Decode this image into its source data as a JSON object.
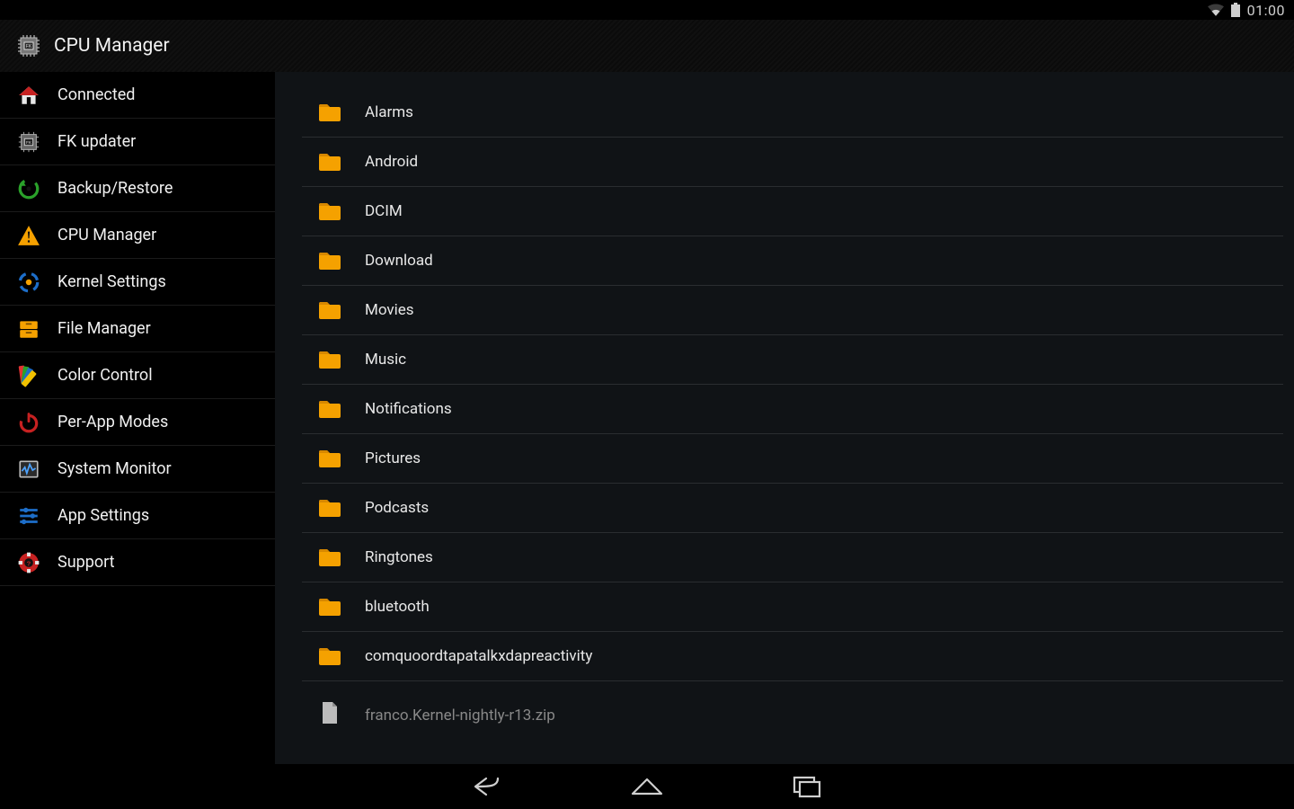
{
  "status": {
    "time": "01:00"
  },
  "header": {
    "title": "CPU Manager"
  },
  "sidebar": {
    "items": [
      {
        "id": "connected",
        "label": "Connected",
        "icon": "home"
      },
      {
        "id": "fk-updater",
        "label": "FK updater",
        "icon": "chip"
      },
      {
        "id": "backup-restore",
        "label": "Backup/Restore",
        "icon": "restore"
      },
      {
        "id": "cpu-manager",
        "label": "CPU Manager",
        "icon": "warning"
      },
      {
        "id": "kernel-settings",
        "label": "Kernel Settings",
        "icon": "target"
      },
      {
        "id": "file-manager",
        "label": "File Manager",
        "icon": "drawer"
      },
      {
        "id": "color-control",
        "label": "Color Control",
        "icon": "swatch"
      },
      {
        "id": "per-app-modes",
        "label": "Per-App Modes",
        "icon": "power"
      },
      {
        "id": "system-monitor",
        "label": "System Monitor",
        "icon": "monitor"
      },
      {
        "id": "app-settings",
        "label": "App Settings",
        "icon": "sliders"
      },
      {
        "id": "support",
        "label": "Support",
        "icon": "lifebuoy"
      }
    ]
  },
  "files": {
    "items": [
      {
        "name": "Alarms",
        "type": "folder"
      },
      {
        "name": "Android",
        "type": "folder"
      },
      {
        "name": "DCIM",
        "type": "folder"
      },
      {
        "name": "Download",
        "type": "folder"
      },
      {
        "name": "Movies",
        "type": "folder"
      },
      {
        "name": "Music",
        "type": "folder"
      },
      {
        "name": "Notifications",
        "type": "folder"
      },
      {
        "name": "Pictures",
        "type": "folder"
      },
      {
        "name": "Podcasts",
        "type": "folder"
      },
      {
        "name": "Ringtones",
        "type": "folder"
      },
      {
        "name": "bluetooth",
        "type": "folder"
      },
      {
        "name": "comquoordtapatalkxdapreactivity",
        "type": "folder"
      },
      {
        "name": "franco.Kernel-nightly-r13.zip",
        "type": "file"
      }
    ]
  }
}
